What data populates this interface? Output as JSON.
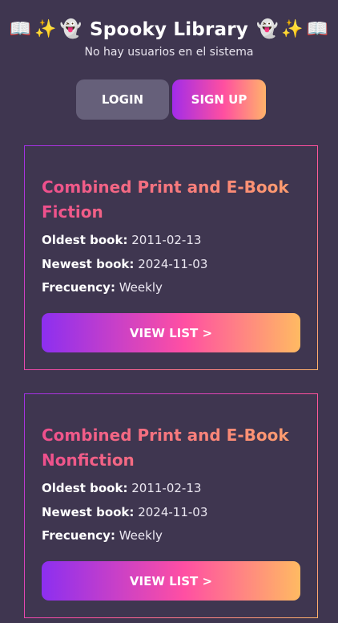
{
  "header": {
    "title": "Spooky Library",
    "subtitle": "No hay usuarios en el sistema",
    "emojis": {
      "book": "📖",
      "sparkles": "✨",
      "ghost": "👻"
    }
  },
  "auth": {
    "login_label": "LOGIN",
    "signup_label": "SIGN UP"
  },
  "labels": {
    "oldest": "Oldest book:",
    "newest": "Newest book:",
    "frequency": "Frecuency:"
  },
  "lists": [
    {
      "title": "Combined Print and E-Book Fiction",
      "oldest": "2011-02-13",
      "newest": "2024-11-03",
      "frequency": "Weekly",
      "button_label": "VIEW LIST >"
    },
    {
      "title": "Combined Print and E-Book Nonfiction",
      "oldest": "2011-02-13",
      "newest": "2024-11-03",
      "frequency": "Weekly",
      "button_label": "VIEW LIST >"
    }
  ],
  "colors": {
    "background": "#3f3650",
    "login_button": "#66607a",
    "gradient_start": "#8c2ff0",
    "gradient_mid": "#ff4fa3",
    "gradient_end": "#ffba62"
  }
}
